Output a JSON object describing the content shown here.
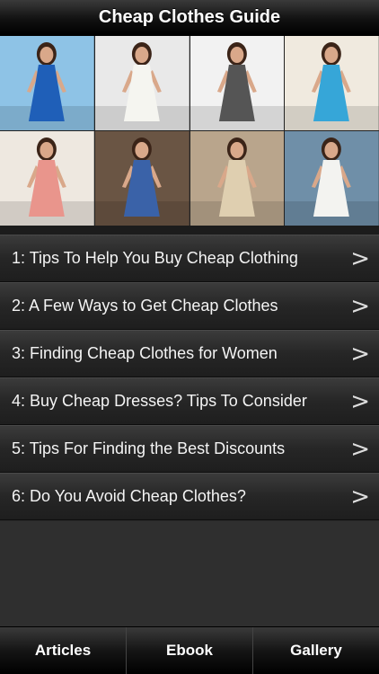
{
  "header": {
    "title": "Cheap Clothes Guide"
  },
  "gallery": {
    "photos": [
      {
        "name": "woman-blue-dress-beach",
        "bg": "#8ec3e6",
        "dress": "#1f5fb8"
      },
      {
        "name": "woman-white-tank",
        "bg": "#e9e9e9",
        "dress": "#f5f5f0"
      },
      {
        "name": "woman-gray-dress",
        "bg": "#f2f2f2",
        "dress": "#555555"
      },
      {
        "name": "woman-turquoise-dress",
        "bg": "#f0eadf",
        "dress": "#36a6d8"
      },
      {
        "name": "woman-pink-dress-room",
        "bg": "#eee8e0",
        "dress": "#e9958c"
      },
      {
        "name": "woman-shoe-store",
        "bg": "#6a5544",
        "dress": "#3a62a8"
      },
      {
        "name": "woman-beige-shirt",
        "bg": "#b9a58c",
        "dress": "#dfcfb0"
      },
      {
        "name": "woman-white-dress-sea",
        "bg": "#6f8fa8",
        "dress": "#f3f3f0"
      }
    ]
  },
  "articles": [
    {
      "label": "1: Tips To Help You Buy Cheap Clothing"
    },
    {
      "label": "2: A Few Ways to Get Cheap Clothes"
    },
    {
      "label": "3: Finding Cheap Clothes for Women"
    },
    {
      "label": "4: Buy Cheap Dresses? Tips To Consider"
    },
    {
      "label": "5: Tips For Finding the Best Discounts"
    },
    {
      "label": "6: Do You Avoid Cheap Clothes?"
    }
  ],
  "chevron": ">",
  "tabs": [
    {
      "label": "Articles"
    },
    {
      "label": "Ebook"
    },
    {
      "label": "Gallery"
    }
  ]
}
